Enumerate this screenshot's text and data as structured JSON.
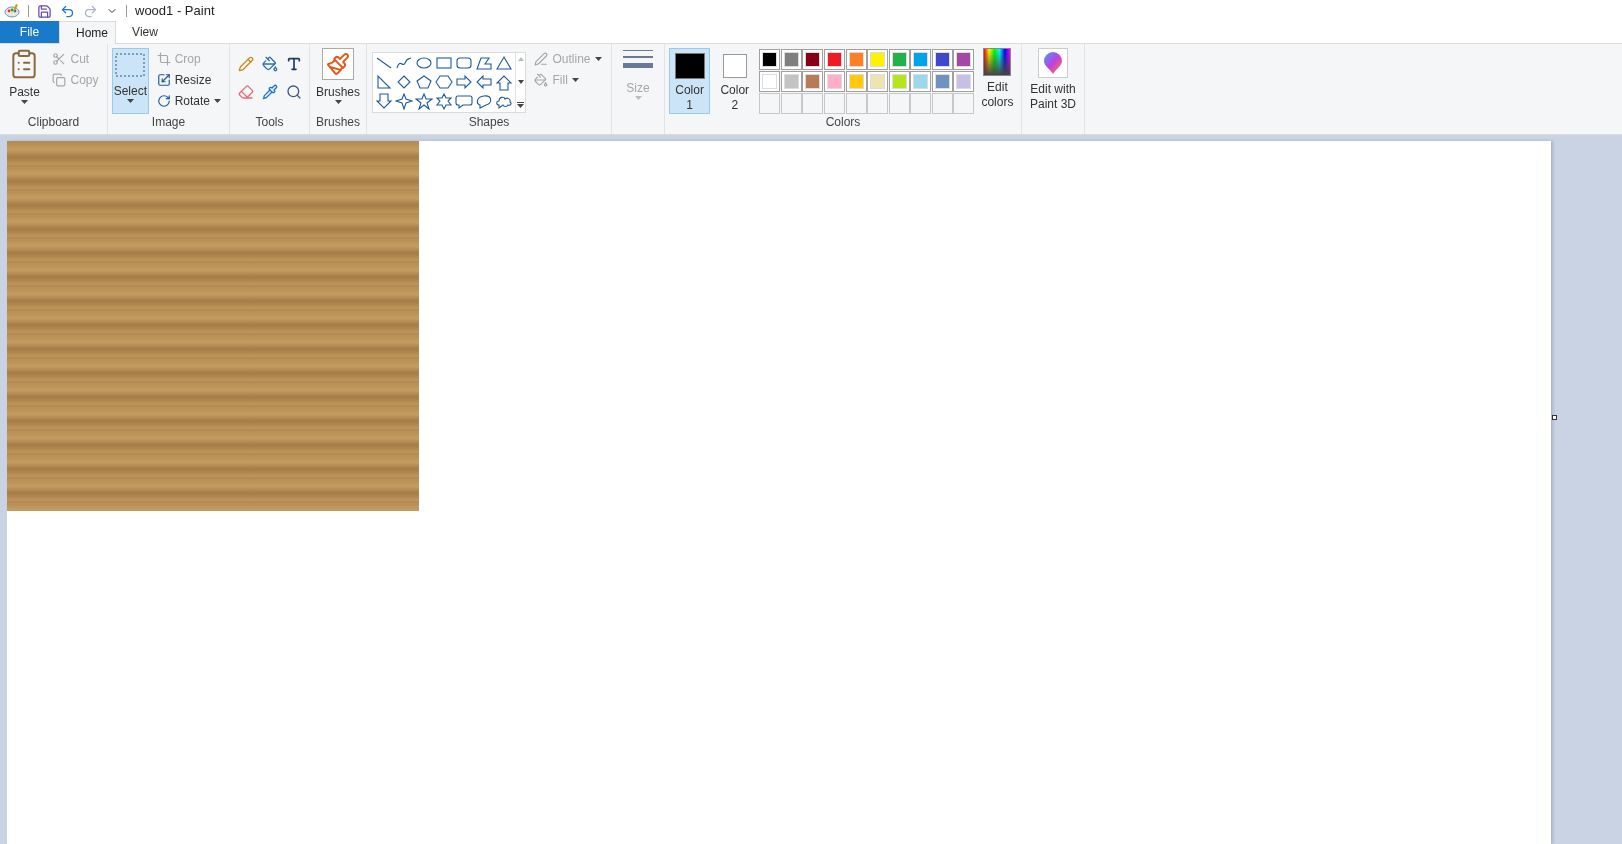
{
  "window": {
    "title": "wood1 - Paint"
  },
  "quick_access": {
    "redo_disabled": true
  },
  "tabs": [
    {
      "label": "File",
      "kind": "file",
      "selected": false
    },
    {
      "label": "Home",
      "kind": "tab",
      "selected": true
    },
    {
      "label": "View",
      "kind": "tab",
      "selected": false
    }
  ],
  "clipboard": {
    "label": "Clipboard",
    "paste": {
      "label": "Paste"
    },
    "cut": {
      "label": "Cut",
      "disabled": true
    },
    "copy": {
      "label": "Copy",
      "disabled": true
    }
  },
  "image": {
    "label": "Image",
    "select": {
      "label": "Select",
      "selected": true
    },
    "crop": {
      "label": "Crop",
      "disabled": true
    },
    "resize": {
      "label": "Resize",
      "disabled": false
    },
    "rotate": {
      "label": "Rotate",
      "disabled": false
    }
  },
  "tools": {
    "label": "Tools"
  },
  "brushes": {
    "label": "Brushes",
    "group_label": "Brushes"
  },
  "shapes": {
    "label": "Shapes",
    "outline": {
      "label": "Outline",
      "disabled": true
    },
    "fill": {
      "label": "Fill",
      "disabled": true
    }
  },
  "size": {
    "label": "Size",
    "disabled": true
  },
  "colors": {
    "label": "Colors",
    "slots": [
      {
        "label": "Color 1",
        "color": "#000000",
        "selected": true
      },
      {
        "label": "Color 2",
        "color": "#ffffff",
        "selected": false
      }
    ],
    "palette": [
      {
        "color": "#000000"
      },
      {
        "color": "#7f7f7f"
      },
      {
        "color": "#880015"
      },
      {
        "color": "#ed1c24"
      },
      {
        "color": "#ff7f27"
      },
      {
        "color": "#fff200"
      },
      {
        "color": "#22b14c"
      },
      {
        "color": "#00a2e8"
      },
      {
        "color": "#3f48cc"
      },
      {
        "color": "#a349a4"
      },
      {
        "color": "#ffffff"
      },
      {
        "color": "#c3c3c3"
      },
      {
        "color": "#b97a57"
      },
      {
        "color": "#ffaec9"
      },
      {
        "color": "#ffc90e"
      },
      {
        "color": "#efe4b0"
      },
      {
        "color": "#b5e61d"
      },
      {
        "color": "#99d9ea"
      },
      {
        "color": "#7092be"
      },
      {
        "color": "#c8bfe7"
      }
    ],
    "custom": [
      {
        "filled": false
      },
      {
        "filled": false
      },
      {
        "filled": false
      },
      {
        "filled": false
      },
      {
        "filled": false
      },
      {
        "filled": false
      },
      {
        "filled": false
      },
      {
        "filled": false
      },
      {
        "filled": false
      },
      {
        "filled": false
      }
    ],
    "edit": {
      "label": "Edit colors"
    }
  },
  "paint3d": {
    "label": "Edit with Paint 3D"
  }
}
